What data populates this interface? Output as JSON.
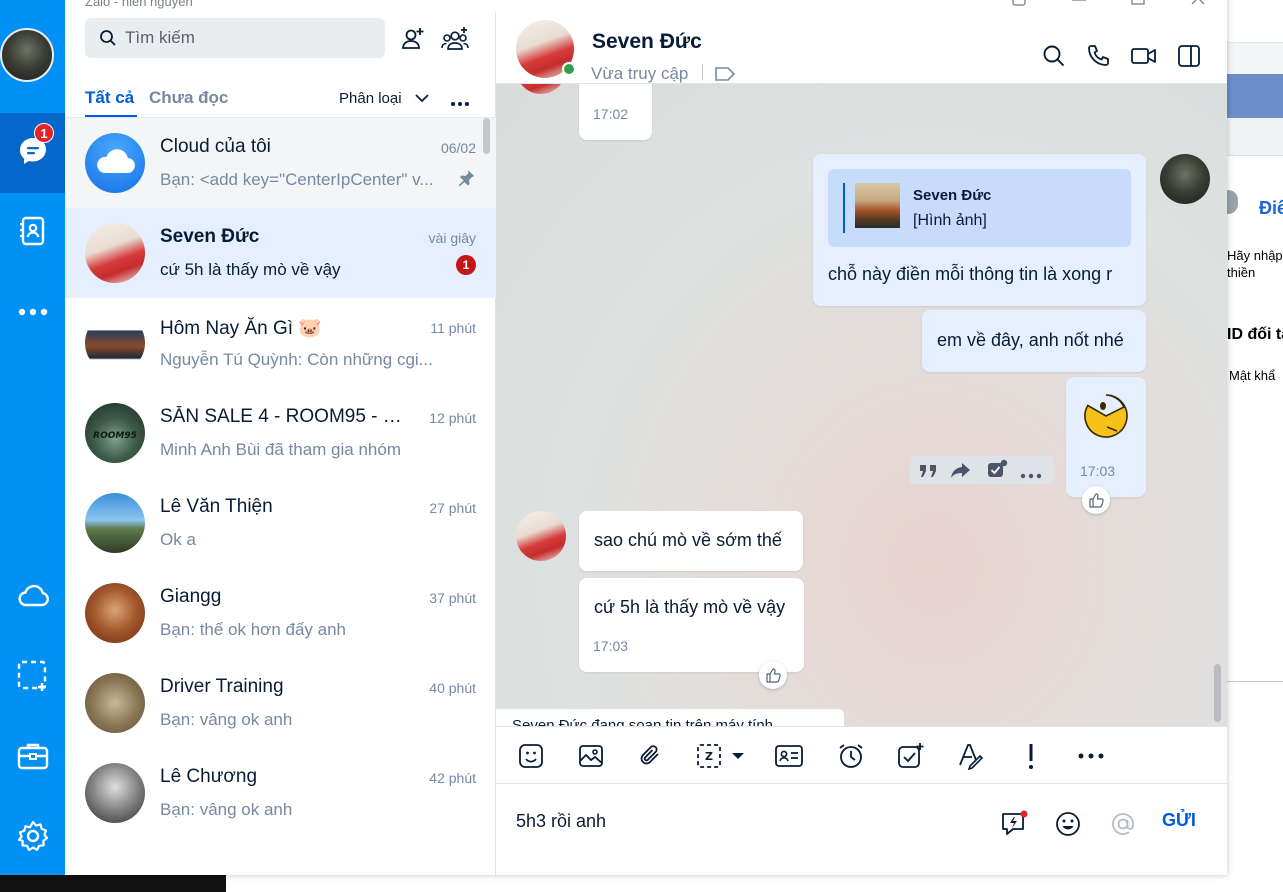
{
  "window_title": "Zalo - hien nguyen",
  "nav": {
    "chat_badge": "1"
  },
  "search": {
    "placeholder": "Tìm kiếm"
  },
  "tabs": {
    "all": "Tất cả",
    "unread": "Chưa đọc",
    "classify": "Phân loại"
  },
  "conversations": [
    {
      "name": "Cloud của tôi",
      "time": "06/02",
      "preview": "Bạn: <add key=\"CenterIpCenter\" v...",
      "pinned": true
    },
    {
      "name": "Seven Đức",
      "time": "vài giây",
      "preview": "cứ 5h là thấy mò về vậy",
      "unread": "1",
      "selected": true
    },
    {
      "name": "Hôm Nay Ăn Gì 🐷",
      "time": "11 phút",
      "preview": "Nguyễn Tú Quỳnh: Còn những cgi..."
    },
    {
      "name": "SĂN SALE 4 - ROOM95 - Z...",
      "time": "12 phút",
      "preview": "Minh Anh Bùi đã tham gia nhóm"
    },
    {
      "name": "Lê Văn Thiện",
      "time": "27 phút",
      "preview": "Ok a"
    },
    {
      "name": "Giangg",
      "time": "37 phút",
      "preview": "Bạn: thế ok hơn đấy anh"
    },
    {
      "name": "Driver Training",
      "time": "40 phút",
      "preview": "Bạn: vâng ok anh"
    },
    {
      "name": "Lê Chương",
      "time": "42 phút",
      "preview": "Bạn: vâng ok anh"
    }
  ],
  "chat": {
    "name": "Seven Đức",
    "status": "Vừa truy cập",
    "messages": {
      "prev_time": "17:02",
      "quote_name": "Seven Đức",
      "quote_text": "[Hình ảnh]",
      "reply_text": "chỗ này điền mỗi thông tin là xong r",
      "msg2": "em về đây, anh nốt nhé",
      "sticker_time": "17:03",
      "in1": "sao chú mò về sớm thế",
      "in2": "cứ 5h là thấy mò về vậy",
      "in2_time": "17:03"
    },
    "typing": "Seven Đức đang soạn tin trên máy tính",
    "input_value": "5h3 rồi anh",
    "send_label": "GỬI"
  },
  "background_app": {
    "heading": "Điể",
    "line1": "Hãy nhập",
    "line2": "thiền",
    "label_id": "ID đối tá",
    "label_pw": "Mật khẩ"
  },
  "colors": {
    "nav": "#0190f3",
    "accent": "#005ae0",
    "unread": "#c31818",
    "online": "#30a24f"
  }
}
